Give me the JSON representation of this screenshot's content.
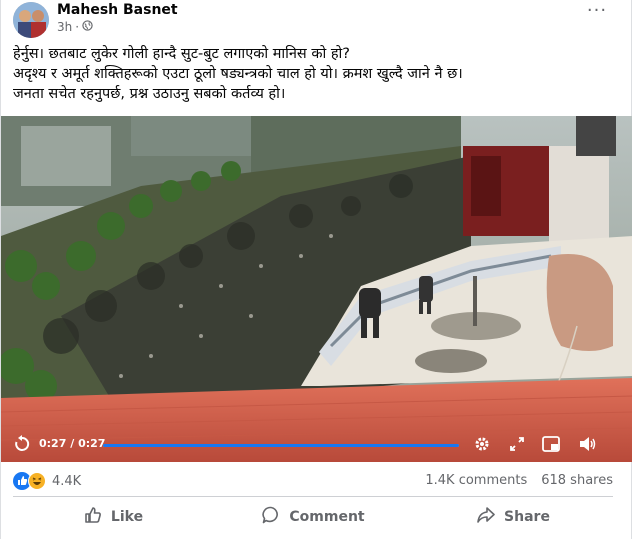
{
  "post": {
    "author": "Mahesh Basnet",
    "time": "3h",
    "time_separator": "·",
    "more_glyph": "···",
    "text_lines": [
      "हेर्नुस। छतबाट लुकेर गोली हान्दै सुट-बुट लगाएको मानिस को हो?",
      "अदृश्य र अमूर्त शक्तिहरूको एउटा ठूलो षड्यन्त्रको चाल हो यो। क्रमश खुल्दै जाने नै छ।",
      "जनता सचेत रहनुपर्छ, प्रश्न उठाउनु सबको कर्तव्य हो।"
    ]
  },
  "video": {
    "current_time": "0:27",
    "separator": "/",
    "duration": "0:27",
    "progress": 1.0
  },
  "stats": {
    "reaction_count": "4.4K",
    "comments": "1.4K comments",
    "shares": "618 shares"
  },
  "actions": {
    "like": "Like",
    "comment": "Comment",
    "share": "Share"
  },
  "colors": {
    "accent": "#1877f2",
    "text": "#050505",
    "secondary": "#65676b",
    "haha": "#f7b125"
  },
  "icons": [
    "globe-icon",
    "more-icon",
    "replay-icon",
    "settings-icon",
    "expand-icon",
    "pip-icon",
    "volume-icon",
    "like-reaction-icon",
    "haha-reaction-icon",
    "like-icon",
    "comment-icon",
    "share-icon"
  ]
}
